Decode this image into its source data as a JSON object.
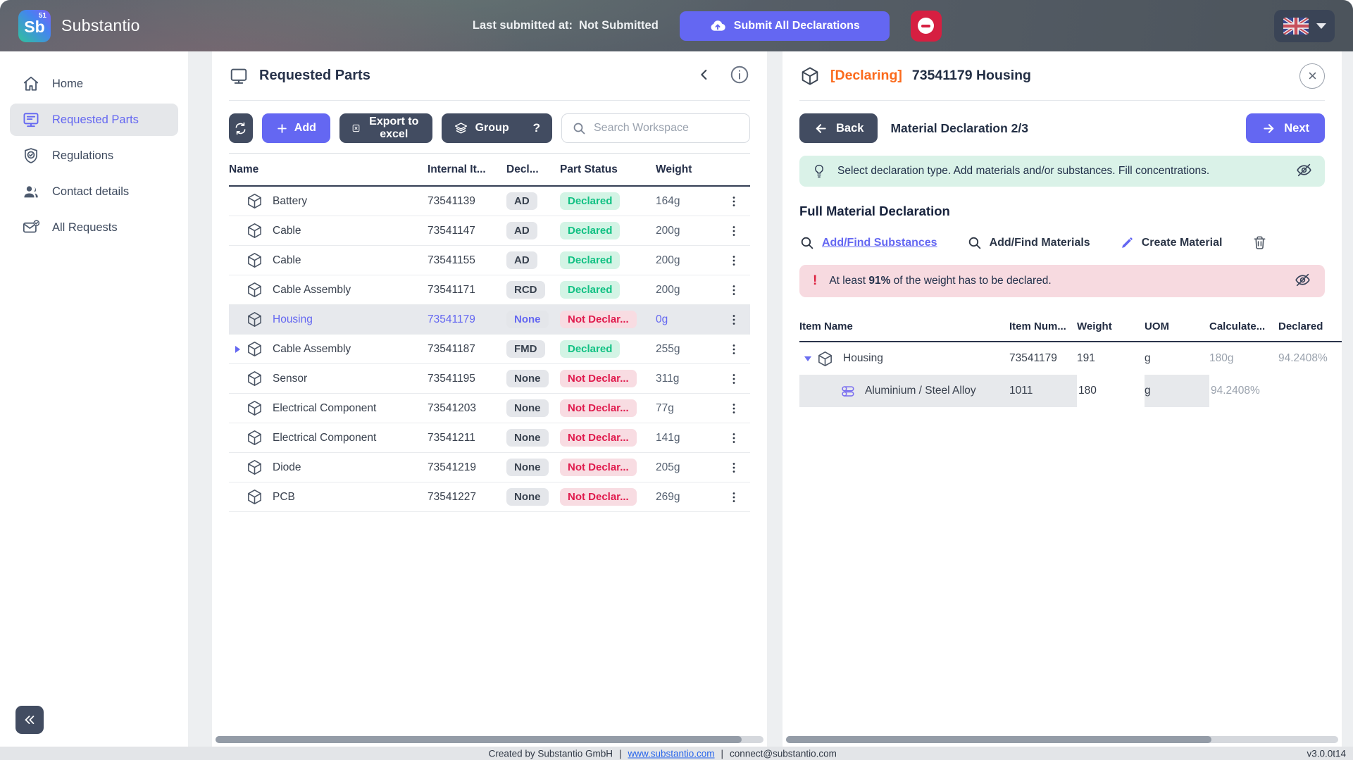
{
  "header": {
    "logo_text": "Sb",
    "logo_sup": "51",
    "app_name": "Substantio",
    "last_submitted_label": "Last submitted at:",
    "last_submitted_value": "Not Submitted",
    "submit_button": "Submit All Declarations"
  },
  "sidebar": {
    "items": [
      {
        "label": "Home",
        "icon": "home-icon",
        "active": false
      },
      {
        "label": "Requested Parts",
        "icon": "monitor-icon",
        "active": true
      },
      {
        "label": "Regulations",
        "icon": "shield-check-icon",
        "active": false
      },
      {
        "label": "Contact details",
        "icon": "users-icon",
        "active": false
      },
      {
        "label": "All Requests",
        "icon": "mail-check-icon",
        "active": false
      }
    ]
  },
  "parts_panel": {
    "title": "Requested Parts",
    "toolbar": {
      "add_label": "Add",
      "export_label": "Export to excel",
      "group_label": "Group",
      "help_label": "?",
      "search_placeholder": "Search Workspace"
    },
    "columns": [
      "Name",
      "Internal It...",
      "Decl...",
      "Part Status",
      "Weight"
    ],
    "rows": [
      {
        "name": "Battery",
        "internal": "73541139",
        "decl_type": "AD",
        "status": "Declared",
        "declared": true,
        "weight": "164g",
        "selected": false,
        "expandable": false
      },
      {
        "name": "Cable",
        "internal": "73541147",
        "decl_type": "AD",
        "status": "Declared",
        "declared": true,
        "weight": "200g",
        "selected": false,
        "expandable": false
      },
      {
        "name": "Cable",
        "internal": "73541155",
        "decl_type": "AD",
        "status": "Declared",
        "declared": true,
        "weight": "200g",
        "selected": false,
        "expandable": false
      },
      {
        "name": "Cable Assembly",
        "internal": "73541171",
        "decl_type": "RCD",
        "status": "Declared",
        "declared": true,
        "weight": "200g",
        "selected": false,
        "expandable": false
      },
      {
        "name": "Housing",
        "internal": "73541179",
        "decl_type": "None",
        "status": "Not Declar...",
        "declared": false,
        "weight": "0g",
        "selected": true,
        "expandable": false
      },
      {
        "name": "Cable Assembly",
        "internal": "73541187",
        "decl_type": "FMD",
        "status": "Declared",
        "declared": true,
        "weight": "255g",
        "selected": false,
        "expandable": true
      },
      {
        "name": "Sensor",
        "internal": "73541195",
        "decl_type": "None",
        "status": "Not Declar...",
        "declared": false,
        "weight": "311g",
        "selected": false,
        "expandable": false
      },
      {
        "name": "Electrical Component",
        "internal": "73541203",
        "decl_type": "None",
        "status": "Not Declar...",
        "declared": false,
        "weight": "77g",
        "selected": false,
        "expandable": false
      },
      {
        "name": "Electrical Component",
        "internal": "73541211",
        "decl_type": "None",
        "status": "Not Declar...",
        "declared": false,
        "weight": "141g",
        "selected": false,
        "expandable": false
      },
      {
        "name": "Diode",
        "internal": "73541219",
        "decl_type": "None",
        "status": "Not Declar...",
        "declared": false,
        "weight": "205g",
        "selected": false,
        "expandable": false
      },
      {
        "name": "PCB",
        "internal": "73541227",
        "decl_type": "None",
        "status": "Not Declar...",
        "declared": false,
        "weight": "269g",
        "selected": false,
        "expandable": false
      }
    ]
  },
  "declaration_panel": {
    "tag": "[Declaring]",
    "title": "73541179 Housing",
    "back_label": "Back",
    "step_label": "Material Declaration 2/3",
    "next_label": "Next",
    "tip": "Select declaration type. Add materials and/or substances. Fill concentrations.",
    "section_title": "Full Material Declaration",
    "actions": {
      "substances": "Add/Find Substances",
      "materials": "Add/Find Materials",
      "create": "Create Material"
    },
    "warning": {
      "prefix": "At least ",
      "bold": "91%",
      "suffix": " of the weight has to be declared."
    },
    "columns": [
      "Item Name",
      "Item Num...",
      "Weight",
      "UOM",
      "Calculate...",
      "Declared"
    ],
    "rows": [
      {
        "name": "Housing",
        "number": "73541179",
        "weight": "191",
        "uom": "g",
        "calculated": "180g",
        "declared": "94.2408%",
        "kind": "part"
      },
      {
        "name": "Aluminium / Steel Alloy",
        "number": "1011",
        "weight": "180",
        "uom": "g",
        "calculated": "",
        "declared": "94.2408%",
        "kind": "material"
      }
    ]
  },
  "footer": {
    "created_by": "Created by Substantio GmbH",
    "separator": "|",
    "website": "www.substantio.com",
    "email": "connect@substantio.com",
    "version": "v3.0.0t14"
  },
  "colors": {
    "accent_purple": "#6467f2",
    "dark_button": "#424c61",
    "declared_green": "#11c183",
    "not_declared_red": "#e01a4d",
    "declaring_orange": "#fb6a1c",
    "tip_bg": "#daf2e8",
    "warning_bg": "#f7dae0",
    "danger_red": "#d61f41"
  }
}
